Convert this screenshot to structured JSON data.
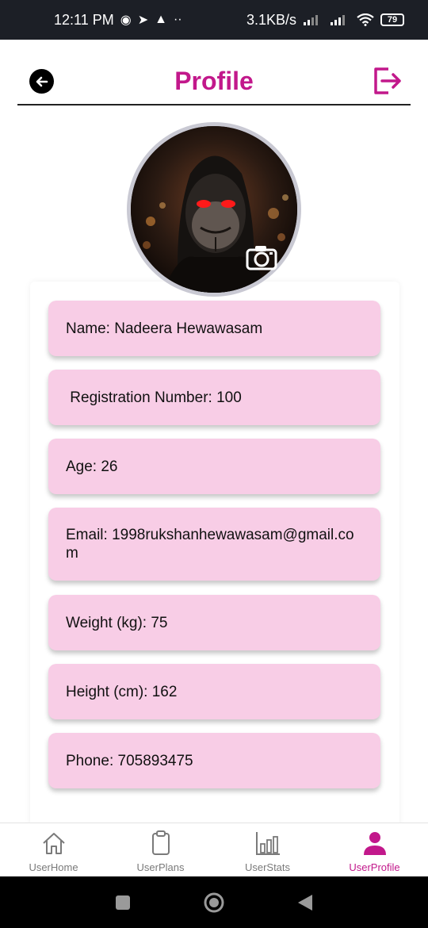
{
  "status_bar": {
    "time": "12:11 PM",
    "net_speed": "3.1KB/s",
    "battery": "79"
  },
  "header": {
    "title": "Profile",
    "back_icon": "arrow-left-icon",
    "logout_icon": "logout-icon"
  },
  "profile": {
    "fields": [
      "Name: Nadeera Hewawasam",
      " Registration Number: 100",
      "Age: 26",
      "Email: 1998rukshanhewawasam@gmail.com",
      "Weight (kg): 75",
      "Height (cm): 162",
      "Phone: 705893475"
    ]
  },
  "bottom_nav": {
    "items": [
      {
        "label": "UserHome",
        "icon": "home-icon"
      },
      {
        "label": "UserPlans",
        "icon": "clipboard-icon"
      },
      {
        "label": "UserStats",
        "icon": "bar-chart-icon"
      },
      {
        "label": "UserProfile",
        "icon": "person-icon",
        "active": true
      }
    ]
  },
  "colors": {
    "accent": "#c2188b",
    "field_bg": "#f8cde6",
    "status_bar_bg": "#1c1f26"
  }
}
